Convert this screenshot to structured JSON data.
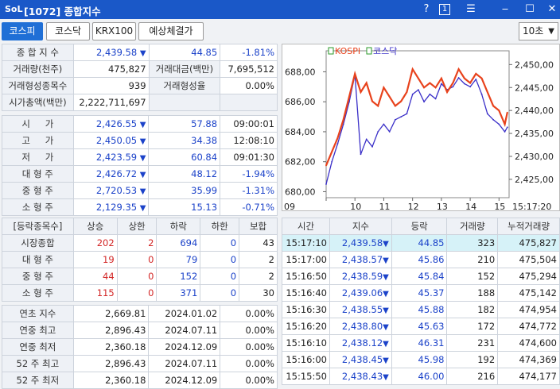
{
  "window": {
    "logo": "SoL",
    "title": "[1072] 종합지수",
    "help": "?",
    "num": "1",
    "menu": "☰",
    "minimize": "‒",
    "maximize": "☐",
    "close": "✕"
  },
  "tabs": [
    "코스피",
    "코스닥",
    "KRX100",
    "예상체결가"
  ],
  "interval": "10초",
  "summary": {
    "r1": {
      "label": "종 합 지 수",
      "value": "2,439.58",
      "arrow": "▼",
      "change": "44.85",
      "pct": "-1.81%"
    },
    "r2": {
      "label1": "거래량(천주)",
      "val1": "475,827",
      "label2": "거래대금(백만)",
      "val2": "7,695,512"
    },
    "r3": {
      "label1": "거래형성종목수",
      "val1": "939",
      "label2": "거래형성율",
      "val2": "0.00%"
    },
    "r4": {
      "label": "시가총액(백만)",
      "value": "2,222,711,697"
    }
  },
  "prices": [
    {
      "label": "시 　 가",
      "value": "2,426.55",
      "arrow": "▼",
      "change": "57.88",
      "extra": "09:00:01"
    },
    {
      "label": "고 　 가",
      "value": "2,450.05",
      "arrow": "▼",
      "change": "34.38",
      "extra": "12:08:10"
    },
    {
      "label": "저 　 가",
      "value": "2,423.59",
      "arrow": "▼",
      "change": "60.84",
      "extra": "09:01:30"
    },
    {
      "label": "대 형 주",
      "value": "2,426.72",
      "arrow": "▼",
      "change": "48.12",
      "extra": "-1.94%"
    },
    {
      "label": "중 형 주",
      "value": "2,720.53",
      "arrow": "▼",
      "change": "35.99",
      "extra": "-1.31%"
    },
    {
      "label": "소 형 주",
      "value": "2,129.35",
      "arrow": "▼",
      "change": "15.13",
      "extra": "-0.71%"
    }
  ],
  "breadth": {
    "headers": [
      "[등락종목수]",
      "상승",
      "상한",
      "하락",
      "하한",
      "보합"
    ],
    "rows": [
      [
        "시장종합",
        "202",
        "2",
        "694",
        "0",
        "43"
      ],
      [
        "대 형 주",
        "19",
        "0",
        "79",
        "0",
        "2"
      ],
      [
        "중 형 주",
        "44",
        "0",
        "152",
        "0",
        "2"
      ],
      [
        "소 형 주",
        "115",
        "0",
        "371",
        "0",
        "30"
      ]
    ]
  },
  "yearly": [
    [
      "연초 지수",
      "2,669.81",
      "2024.01.02",
      "0.00%"
    ],
    [
      "연중 최고",
      "2,896.43",
      "2024.07.11",
      "0.00%"
    ],
    [
      "연중 최저",
      "2,360.18",
      "2024.12.09",
      "0.00%"
    ],
    [
      "52 주 최고",
      "2,896.43",
      "2024.07.11",
      "0.00%"
    ],
    [
      "52 주 최저",
      "2,360.18",
      "2024.12.09",
      "0.00%"
    ]
  ],
  "ticks": {
    "headers": [
      "시간",
      "지수",
      "등락",
      "거래량",
      "누적거래량"
    ],
    "rows": [
      [
        "15:17:10",
        "2,439.58",
        "▼",
        "44.85",
        "323",
        "475,827"
      ],
      [
        "15:17:00",
        "2,438.57",
        "▼",
        "45.86",
        "210",
        "475,504"
      ],
      [
        "15:16:50",
        "2,438.59",
        "▼",
        "45.84",
        "152",
        "475,294"
      ],
      [
        "15:16:40",
        "2,439.06",
        "▼",
        "45.37",
        "188",
        "475,142"
      ],
      [
        "15:16:30",
        "2,438.55",
        "▼",
        "45.88",
        "182",
        "474,954"
      ],
      [
        "15:16:20",
        "2,438.80",
        "▼",
        "45.63",
        "172",
        "474,772"
      ],
      [
        "15:16:10",
        "2,438.12",
        "▼",
        "46.31",
        "231",
        "474,600"
      ],
      [
        "15:16:00",
        "2,438.45",
        "▼",
        "45.98",
        "192",
        "474,369"
      ],
      [
        "15:15:50",
        "2,438.43",
        "▼",
        "46.00",
        "216",
        "474,177"
      ]
    ]
  },
  "chart_data": {
    "type": "line",
    "series": [
      {
        "name": "KOSPI",
        "color": "#e8421c",
        "axis": "right",
        "x": [
          9.0,
          9.2,
          9.4,
          9.6,
          9.8,
          10.0,
          10.2,
          10.4,
          10.6,
          10.8,
          11.0,
          11.2,
          11.4,
          11.6,
          11.8,
          12.0,
          12.2,
          12.4,
          12.6,
          12.8,
          13.0,
          13.2,
          13.4,
          13.6,
          13.8,
          14.0,
          14.2,
          14.4,
          14.6,
          14.8,
          15.0,
          15.2,
          15.29
        ],
        "y": [
          2428,
          2431,
          2434,
          2438,
          2443,
          2448,
          2444,
          2446,
          2442,
          2441,
          2445,
          2443,
          2441,
          2442,
          2444,
          2449,
          2447,
          2445,
          2446,
          2445,
          2447,
          2444,
          2446,
          2449,
          2447,
          2446,
          2448,
          2447,
          2444,
          2441,
          2440,
          2437,
          2439.58
        ]
      },
      {
        "name": "코스닥",
        "color": "#3a2fc8",
        "axis": "left",
        "x": [
          9.0,
          9.2,
          9.4,
          9.6,
          9.8,
          10.0,
          10.2,
          10.4,
          10.6,
          10.8,
          11.0,
          11.2,
          11.4,
          11.6,
          11.8,
          12.0,
          12.2,
          12.4,
          12.6,
          12.8,
          13.0,
          13.2,
          13.4,
          13.6,
          13.8,
          14.0,
          14.2,
          14.4,
          14.6,
          14.8,
          15.0,
          15.2,
          15.29
        ],
        "y": [
          680.5,
          682.0,
          683.2,
          684.5,
          686.0,
          687.8,
          682.5,
          683.5,
          683.0,
          684.0,
          684.5,
          684.0,
          684.8,
          685.0,
          685.2,
          686.5,
          686.8,
          686.0,
          686.5,
          686.2,
          687.2,
          686.8,
          687.0,
          687.6,
          687.2,
          687.0,
          687.5,
          686.5,
          685.2,
          684.8,
          684.5,
          684.0,
          684.3
        ]
      }
    ],
    "y_right": {
      "ticks": [
        "2,450,00",
        "2,445,00",
        "2,440,00",
        "2,435,00",
        "2,430,00",
        "2,425,00"
      ],
      "range": [
        2421,
        2453
      ]
    },
    "y_left": {
      "ticks": [
        "688,00",
        "686,00",
        "684,00",
        "682,00",
        "680,00"
      ],
      "range": [
        679.6,
        689.4
      ]
    },
    "x_ticks": [
      "09",
      "10",
      "11",
      "12",
      "13",
      "14",
      "15"
    ],
    "x_corner": "15:17:20"
  }
}
